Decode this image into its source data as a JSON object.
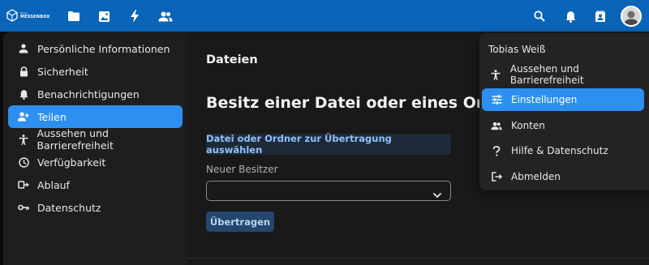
{
  "header": {
    "logo_small": "Open",
    "logo_main": "MESSENBOX",
    "icons": [
      "files-icon",
      "photos-icon",
      "activity-icon",
      "contacts-icon",
      "search-icon",
      "notifications-icon",
      "contacts-menu-icon"
    ]
  },
  "sidebar": {
    "items": [
      {
        "label": "Persönliche Informationen",
        "icon": "person-icon",
        "active": false
      },
      {
        "label": "Sicherheit",
        "icon": "lock-icon",
        "active": false
      },
      {
        "label": "Benachrichtigungen",
        "icon": "bell-icon",
        "active": false
      },
      {
        "label": "Teilen",
        "icon": "share-user-icon",
        "active": true
      },
      {
        "label": "Aussehen und Barrierefreiheit",
        "icon": "accessibility-icon",
        "active": false
      },
      {
        "label": "Verfügbarkeit",
        "icon": "clock-icon",
        "active": false
      },
      {
        "label": "Ablauf",
        "icon": "flow-icon",
        "active": false
      },
      {
        "label": "Datenschutz",
        "icon": "key-icon",
        "active": false
      }
    ]
  },
  "main": {
    "title": "Dateien",
    "section_title": "Besitz einer Datei oder eines Ordners ü",
    "select_button": "Datei oder Ordner zur Übertragung auswählen",
    "new_owner_label": "Neuer Besitzer",
    "new_owner_value": "",
    "transfer_button": "Übertragen"
  },
  "user_menu": {
    "name": "Tobias Weiß",
    "items": [
      {
        "label": "Aussehen und Barrierefreiheit",
        "icon": "accessibility-icon",
        "active": false
      },
      {
        "label": "Einstellungen",
        "icon": "settings-sliders-icon",
        "active": true
      },
      {
        "label": "Konten",
        "icon": "accounts-icon",
        "active": false
      },
      {
        "label": "Hilfe & Datenschutz",
        "icon": "help-icon",
        "active": false
      },
      {
        "label": "Abmelden",
        "icon": "logout-icon",
        "active": false
      }
    ]
  },
  "colors": {
    "header": "#0a64b8",
    "accent": "#2d90f0",
    "sidebar": "#1e1e1e",
    "main": "#191919"
  }
}
